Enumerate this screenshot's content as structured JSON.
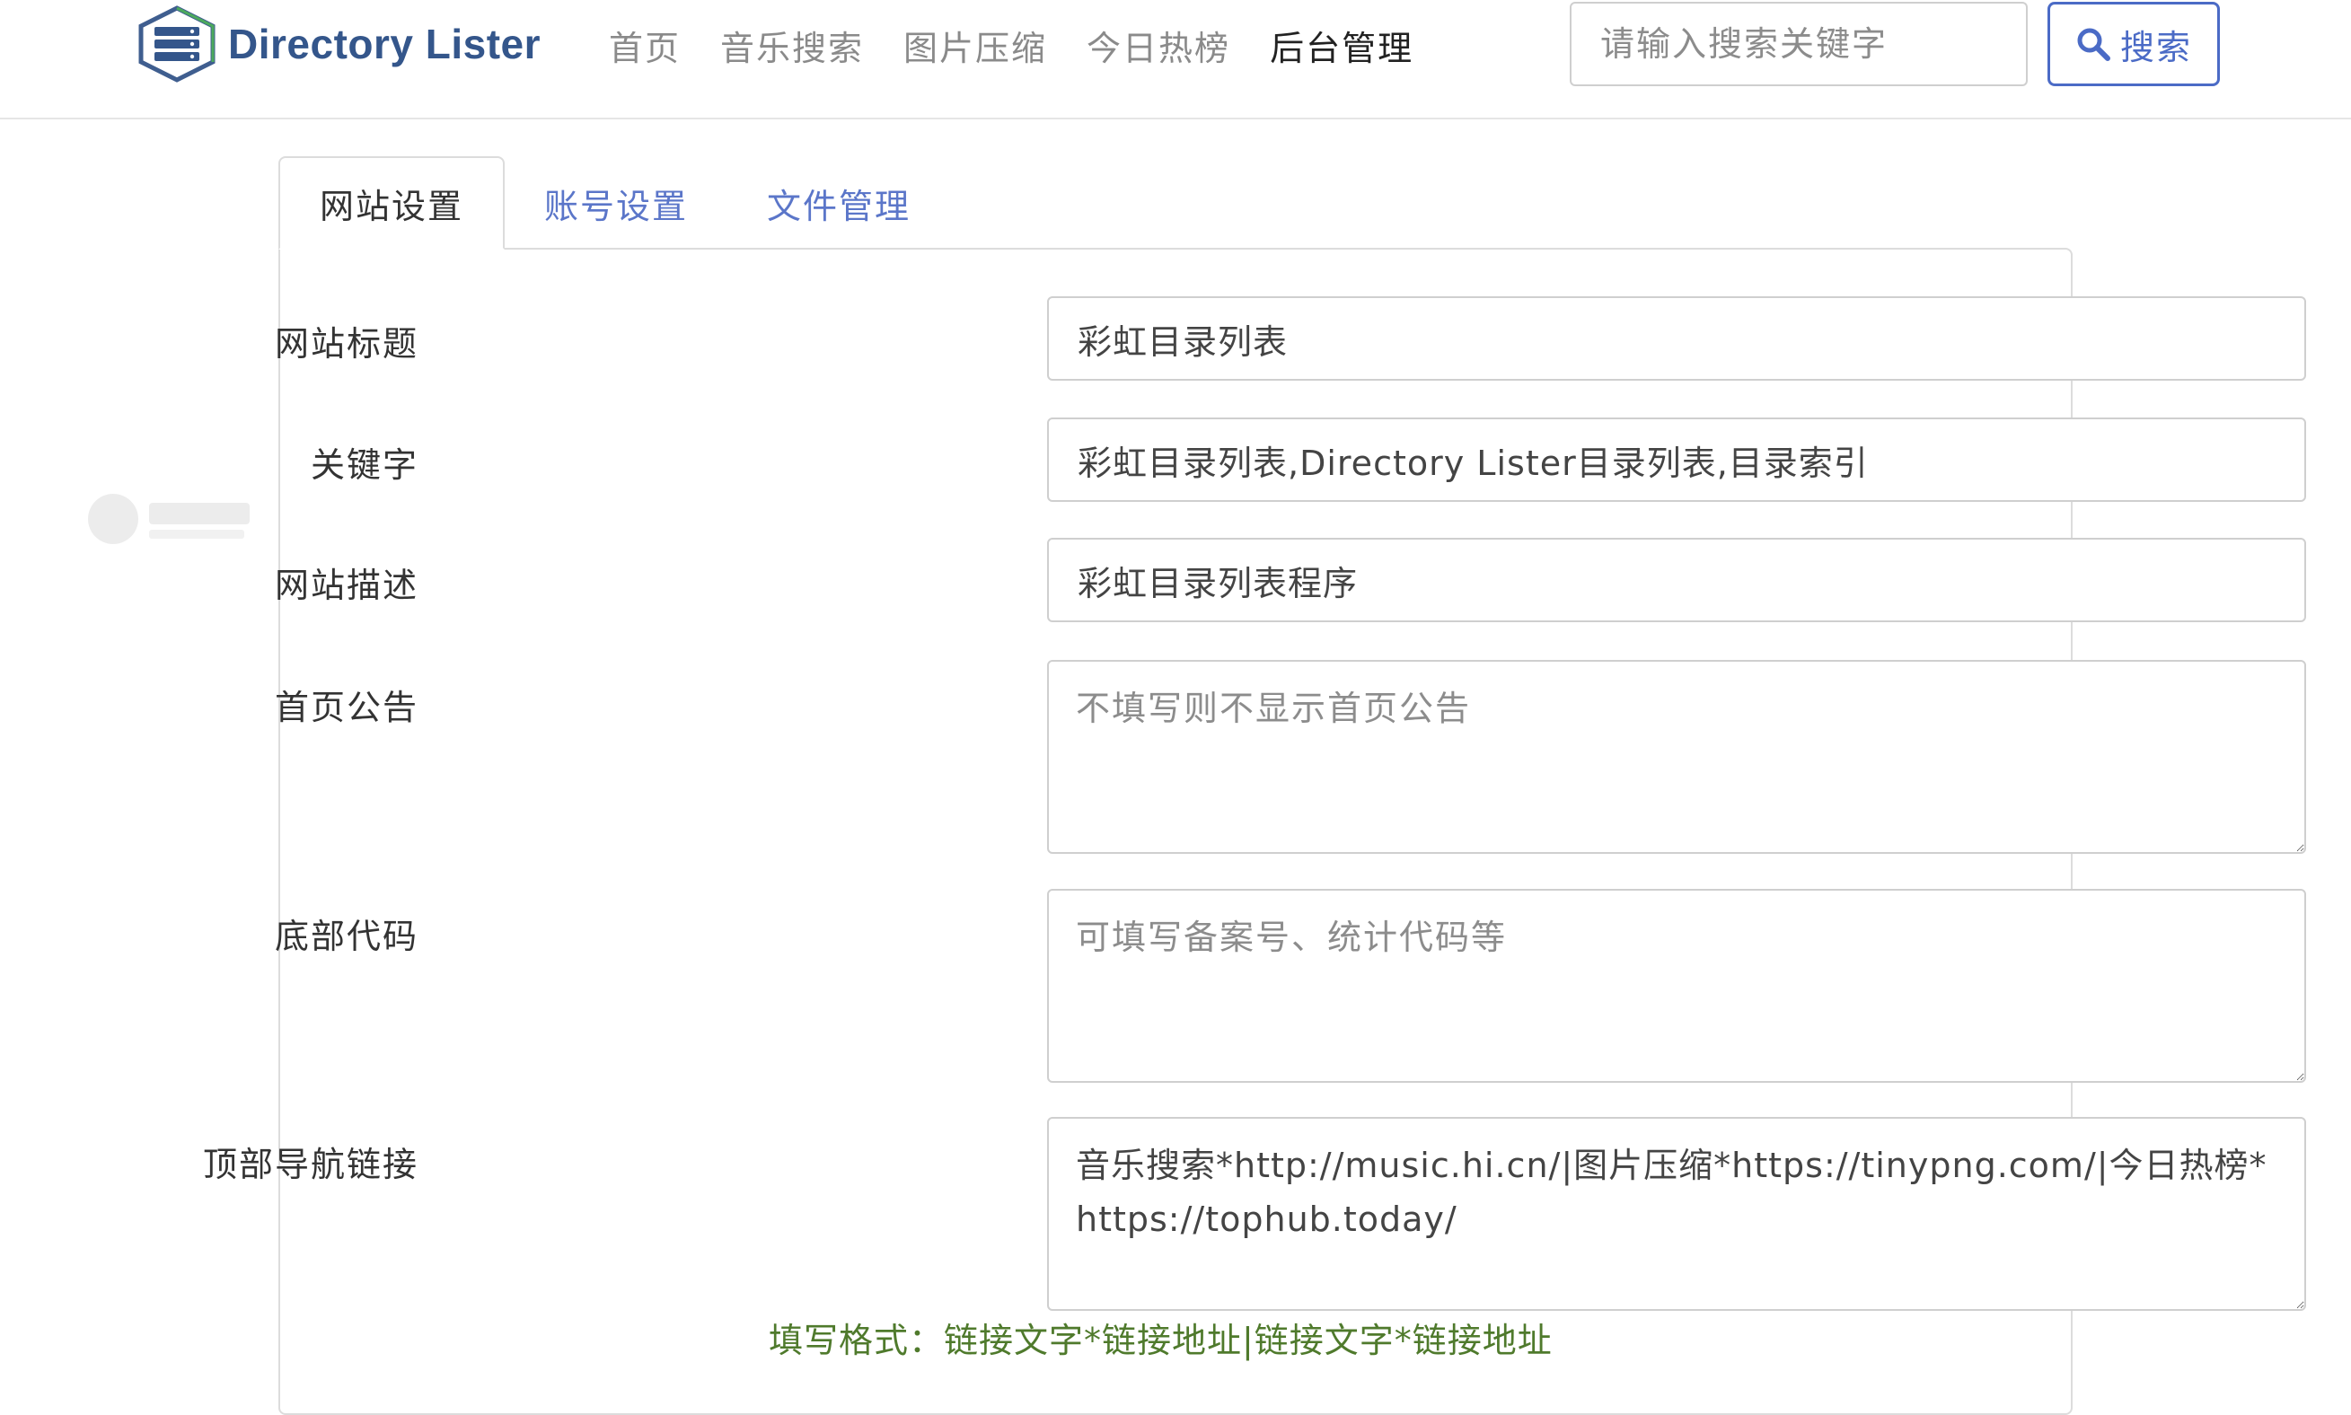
{
  "brand": {
    "name": "Directory Lister"
  },
  "nav": {
    "items": [
      {
        "label": "首页",
        "active": false
      },
      {
        "label": "音乐搜索",
        "active": false
      },
      {
        "label": "图片压缩",
        "active": false
      },
      {
        "label": "今日热榜",
        "active": false
      },
      {
        "label": "后台管理",
        "active": true
      }
    ]
  },
  "search": {
    "placeholder": "请输入搜索关键字",
    "value": "",
    "button_label": "搜索"
  },
  "tabs": [
    {
      "label": "网站设置",
      "active": true
    },
    {
      "label": "账号设置",
      "active": false
    },
    {
      "label": "文件管理",
      "active": false
    }
  ],
  "form": {
    "site_title": {
      "label": "网站标题",
      "value": "彩虹目录列表"
    },
    "keywords": {
      "label": "关键字",
      "value": "彩虹目录列表,Directory Lister目录列表,目录索引"
    },
    "description": {
      "label": "网站描述",
      "value": "彩虹目录列表程序"
    },
    "announcement": {
      "label": "首页公告",
      "value": "",
      "placeholder": "不填写则不显示首页公告"
    },
    "footer_code": {
      "label": "底部代码",
      "value": "",
      "placeholder": "可填写备案号、统计代码等"
    },
    "top_nav_links": {
      "label": "顶部导航链接",
      "value": "音乐搜索*http://music.hi.cn/|图片压缩*https://tinypng.com/|今日热榜*https://tophub.today/",
      "help": "填写格式：链接文字*链接地址|链接文字*链接地址"
    }
  },
  "colors": {
    "brand": "#34568b",
    "link": "#5b76c9",
    "primary_button": "#4b6bc6",
    "help_text": "#4f7a2c"
  },
  "icons": {
    "brand_logo": "server-hexagon-icon",
    "search": "magnifier-icon",
    "watermark": "yimazhan-watermark"
  }
}
